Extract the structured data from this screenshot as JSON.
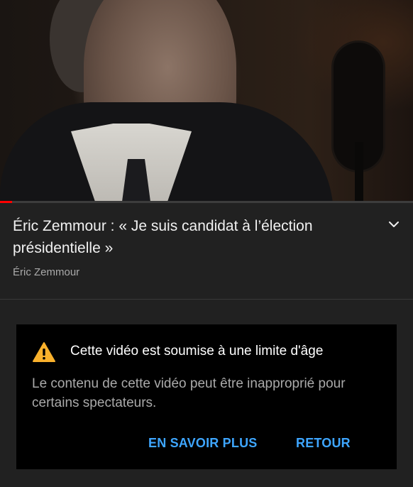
{
  "video": {
    "progress_fraction": 0.03,
    "accent_color": "#ff0000"
  },
  "info": {
    "title": "Éric Zemmour : « Je suis candidat à l’élection présidentielle »",
    "channel": "Éric Zemmour",
    "expand_icon": "chevron-down-icon"
  },
  "dialog": {
    "icon": "warning-icon",
    "title": "Cette vidéo est soumise à une limite d'âge",
    "body": "Le contenu de cette vidéo peut être inapproprié pour certains spectateurs.",
    "learn_more_label": "EN SAVOIR PLUS",
    "back_label": "RETOUR",
    "button_color": "#3ea6ff"
  }
}
